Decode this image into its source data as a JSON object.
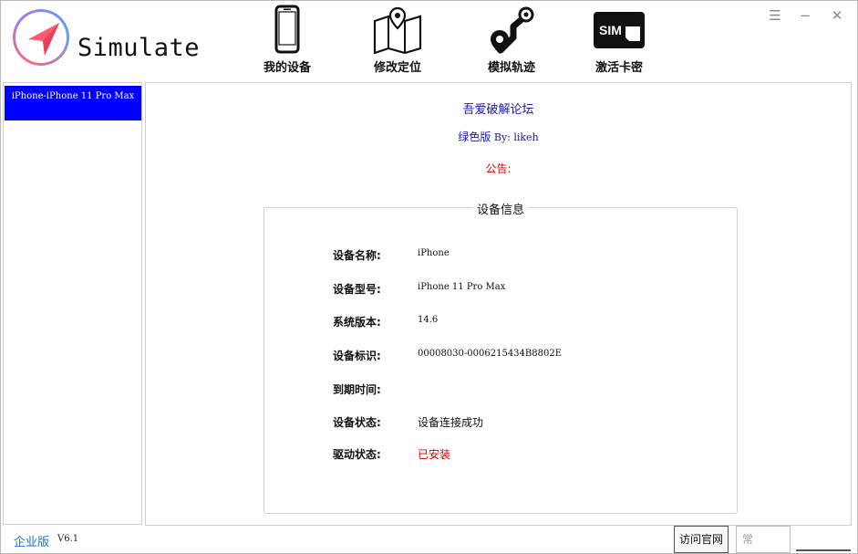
{
  "app": {
    "title": "Simulate"
  },
  "nav": {
    "items": [
      {
        "label": "我的设备",
        "icon": "phone-icon"
      },
      {
        "label": "修改定位",
        "icon": "map-pin-icon"
      },
      {
        "label": "模拟轨迹",
        "icon": "route-icon"
      },
      {
        "label": "激活卡密",
        "icon": "sim-card-icon"
      }
    ],
    "sim_text": "SIM"
  },
  "window_controls": {
    "menu": "☰",
    "minimize": "−",
    "close": "✕"
  },
  "devices": [
    {
      "label": "iPhone-iPhone 11 Pro Max",
      "selected": true
    }
  ],
  "main": {
    "forum": "吾爱破解论坛",
    "green_version": "绿色版",
    "by_text": " By: likeh",
    "notice_label": "公告:"
  },
  "device_info": {
    "legend": "设备信息",
    "rows": [
      {
        "key": "设备名称:",
        "value": "iPhone"
      },
      {
        "key": "设备型号:",
        "value": "iPhone 11 Pro Max"
      },
      {
        "key": "系统版本:",
        "value": "14.6"
      },
      {
        "key": "设备标识:",
        "value": "00008030-0006215434B8802E"
      },
      {
        "key": "到期时间:",
        "value": ""
      },
      {
        "key": "设备状态:",
        "value": "设备连接成功"
      },
      {
        "key": "驱动状态:",
        "value": "已安装"
      }
    ]
  },
  "footer": {
    "edition": "企业版",
    "version": "V6.1",
    "visit_button": "访问官网",
    "partial_button": "常"
  },
  "colors": {
    "selected_device_bg": "#0000ff",
    "link_blue": "#1a1aa6",
    "alert_red": "#d40000",
    "edition_blue": "#1a6fd0"
  }
}
